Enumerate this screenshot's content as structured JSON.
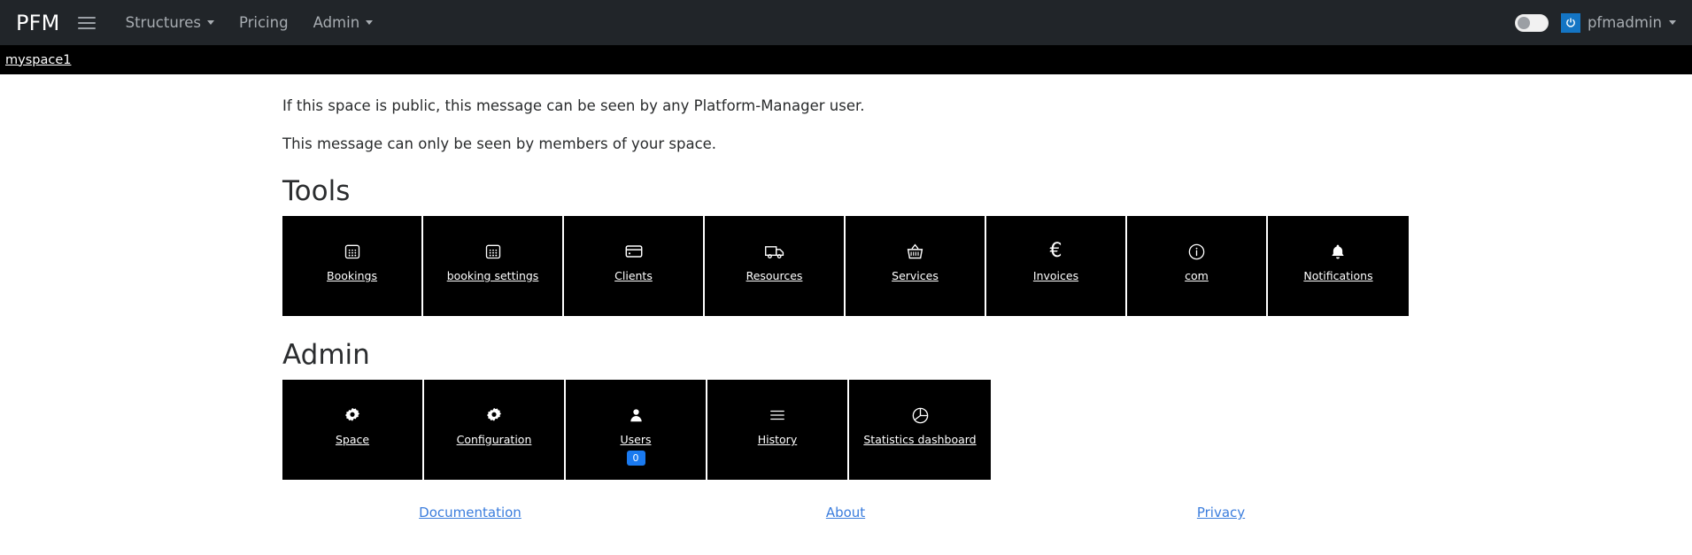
{
  "navbar": {
    "brand": "PFM",
    "menu_icon": "hamburger-icon",
    "items": [
      {
        "label": "Structures",
        "has_caret": true
      },
      {
        "label": "Pricing",
        "has_caret": false
      },
      {
        "label": "Admin",
        "has_caret": true
      }
    ],
    "theme_toggle": {
      "state": "off"
    },
    "user": {
      "name": "pfmadmin",
      "avatar_icon": "power-icon",
      "avatar_color": "#1475c4",
      "has_caret": true
    }
  },
  "breadcrumb": {
    "space": "myspace1"
  },
  "messages": {
    "public": "If this space is public, this message can be seen by any Platform-Manager user.",
    "private": "This message can only be seen by members of your space."
  },
  "tools": {
    "title": "Tools",
    "tiles": [
      {
        "label": "Bookings",
        "icon": "calendar-icon"
      },
      {
        "label": "booking settings",
        "icon": "calendar-icon"
      },
      {
        "label": "Clients",
        "icon": "credit-card-icon"
      },
      {
        "label": "Resources",
        "icon": "truck-icon"
      },
      {
        "label": "Services",
        "icon": "basket-icon"
      },
      {
        "label": "Invoices",
        "icon": "euro-icon",
        "glyph": "€"
      },
      {
        "label": "com",
        "icon": "info-circle-icon"
      },
      {
        "label": "Notifications",
        "icon": "bell-icon"
      }
    ]
  },
  "admin": {
    "title": "Admin",
    "tiles": [
      {
        "label": "Space",
        "icon": "gear-icon"
      },
      {
        "label": "Configuration",
        "icon": "gear-icon"
      },
      {
        "label": "Users",
        "icon": "user-icon",
        "badge": "0",
        "badge_color": "#1a7af0"
      },
      {
        "label": "History",
        "icon": "list-icon"
      },
      {
        "label": "Statistics dashboard",
        "icon": "pie-chart-icon"
      }
    ]
  },
  "footer": {
    "links": [
      {
        "label": "Documentation"
      },
      {
        "label": "About"
      },
      {
        "label": "Privacy"
      }
    ],
    "link_color": "#3b7ddd"
  }
}
